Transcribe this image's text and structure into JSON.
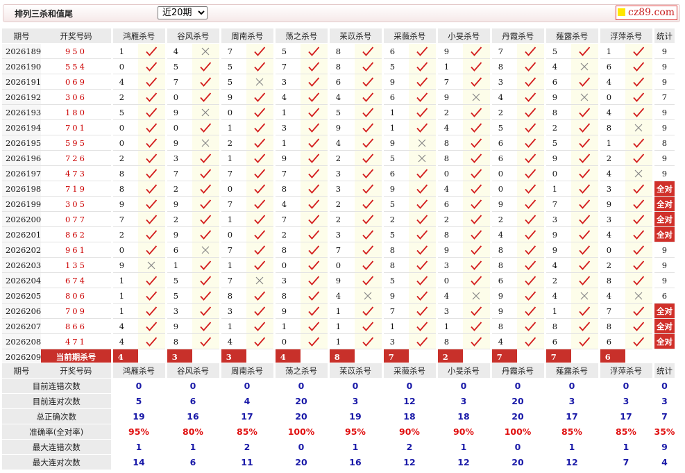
{
  "header": {
    "title": "排列三杀和值尾",
    "period_options": [
      "近20期"
    ],
    "period_selected": "近20期",
    "logo_text": "cz89.com"
  },
  "colors": {
    "red": "#c8302a",
    "blue": "#1a1aa8",
    "right_mark": "#d42020",
    "wrong_mark": "#888888"
  },
  "columns": {
    "issue": "期号",
    "draw": "开奖号码",
    "experts": [
      "鸿雁杀号",
      "谷风杀号",
      "周南杀号",
      "荡之杀号",
      "苿苡杀号",
      "采薇杀号",
      "小旻杀号",
      "丹霞杀号",
      "薤露杀号",
      "浮萍杀号"
    ],
    "total": "统计"
  },
  "rows": [
    {
      "issue": "2026189",
      "draw": "950",
      "picks": [
        [
          1,
          "r"
        ],
        [
          4,
          "w"
        ],
        [
          7,
          "r"
        ],
        [
          5,
          "r"
        ],
        [
          8,
          "r"
        ],
        [
          6,
          "r"
        ],
        [
          9,
          "r"
        ],
        [
          7,
          "r"
        ],
        [
          5,
          "r"
        ],
        [
          1,
          "r"
        ]
      ],
      "total": "9"
    },
    {
      "issue": "2026190",
      "draw": "554",
      "picks": [
        [
          0,
          "r"
        ],
        [
          5,
          "r"
        ],
        [
          5,
          "r"
        ],
        [
          7,
          "r"
        ],
        [
          8,
          "r"
        ],
        [
          5,
          "r"
        ],
        [
          1,
          "r"
        ],
        [
          8,
          "r"
        ],
        [
          4,
          "w"
        ],
        [
          6,
          "r"
        ]
      ],
      "total": "9"
    },
    {
      "issue": "2026191",
      "draw": "069",
      "picks": [
        [
          4,
          "r"
        ],
        [
          7,
          "r"
        ],
        [
          5,
          "w"
        ],
        [
          3,
          "r"
        ],
        [
          6,
          "r"
        ],
        [
          9,
          "r"
        ],
        [
          7,
          "r"
        ],
        [
          3,
          "r"
        ],
        [
          6,
          "r"
        ],
        [
          4,
          "r"
        ]
      ],
      "total": "9"
    },
    {
      "issue": "2026192",
      "draw": "306",
      "picks": [
        [
          2,
          "r"
        ],
        [
          0,
          "r"
        ],
        [
          9,
          "r"
        ],
        [
          4,
          "r"
        ],
        [
          4,
          "r"
        ],
        [
          6,
          "r"
        ],
        [
          9,
          "w"
        ],
        [
          4,
          "r"
        ],
        [
          9,
          "w"
        ],
        [
          0,
          "r"
        ]
      ],
      "total": "7"
    },
    {
      "issue": "2026193",
      "draw": "180",
      "picks": [
        [
          5,
          "r"
        ],
        [
          9,
          "w"
        ],
        [
          0,
          "r"
        ],
        [
          1,
          "r"
        ],
        [
          5,
          "r"
        ],
        [
          1,
          "r"
        ],
        [
          2,
          "r"
        ],
        [
          2,
          "r"
        ],
        [
          8,
          "r"
        ],
        [
          4,
          "r"
        ]
      ],
      "total": "9"
    },
    {
      "issue": "2026194",
      "draw": "701",
      "picks": [
        [
          0,
          "r"
        ],
        [
          0,
          "r"
        ],
        [
          1,
          "r"
        ],
        [
          3,
          "r"
        ],
        [
          9,
          "r"
        ],
        [
          1,
          "r"
        ],
        [
          4,
          "r"
        ],
        [
          5,
          "r"
        ],
        [
          2,
          "r"
        ],
        [
          8,
          "w"
        ]
      ],
      "total": "9"
    },
    {
      "issue": "2026195",
      "draw": "595",
      "picks": [
        [
          0,
          "r"
        ],
        [
          9,
          "w"
        ],
        [
          2,
          "r"
        ],
        [
          1,
          "r"
        ],
        [
          4,
          "r"
        ],
        [
          9,
          "w"
        ],
        [
          8,
          "r"
        ],
        [
          6,
          "r"
        ],
        [
          5,
          "r"
        ],
        [
          1,
          "r"
        ]
      ],
      "total": "8"
    },
    {
      "issue": "2026196",
      "draw": "726",
      "picks": [
        [
          2,
          "r"
        ],
        [
          3,
          "r"
        ],
        [
          1,
          "r"
        ],
        [
          9,
          "r"
        ],
        [
          2,
          "r"
        ],
        [
          5,
          "w"
        ],
        [
          8,
          "r"
        ],
        [
          6,
          "r"
        ],
        [
          9,
          "r"
        ],
        [
          2,
          "r"
        ]
      ],
      "total": "9"
    },
    {
      "issue": "2026197",
      "draw": "473",
      "picks": [
        [
          8,
          "r"
        ],
        [
          7,
          "r"
        ],
        [
          7,
          "r"
        ],
        [
          7,
          "r"
        ],
        [
          3,
          "r"
        ],
        [
          6,
          "r"
        ],
        [
          0,
          "r"
        ],
        [
          0,
          "r"
        ],
        [
          0,
          "r"
        ],
        [
          4,
          "w"
        ]
      ],
      "total": "9"
    },
    {
      "issue": "2026198",
      "draw": "719",
      "picks": [
        [
          8,
          "r"
        ],
        [
          2,
          "r"
        ],
        [
          0,
          "r"
        ],
        [
          8,
          "r"
        ],
        [
          3,
          "r"
        ],
        [
          9,
          "r"
        ],
        [
          4,
          "r"
        ],
        [
          0,
          "r"
        ],
        [
          1,
          "r"
        ],
        [
          3,
          "r"
        ]
      ],
      "total": "全对"
    },
    {
      "issue": "2026199",
      "draw": "305",
      "picks": [
        [
          9,
          "r"
        ],
        [
          9,
          "r"
        ],
        [
          7,
          "r"
        ],
        [
          4,
          "r"
        ],
        [
          2,
          "r"
        ],
        [
          5,
          "r"
        ],
        [
          6,
          "r"
        ],
        [
          9,
          "r"
        ],
        [
          7,
          "r"
        ],
        [
          9,
          "r"
        ]
      ],
      "total": "全对"
    },
    {
      "issue": "2026200",
      "draw": "077",
      "picks": [
        [
          7,
          "r"
        ],
        [
          2,
          "r"
        ],
        [
          1,
          "r"
        ],
        [
          7,
          "r"
        ],
        [
          2,
          "r"
        ],
        [
          2,
          "r"
        ],
        [
          2,
          "r"
        ],
        [
          2,
          "r"
        ],
        [
          3,
          "r"
        ],
        [
          3,
          "r"
        ]
      ],
      "total": "全对"
    },
    {
      "issue": "2026201",
      "draw": "862",
      "picks": [
        [
          2,
          "r"
        ],
        [
          9,
          "r"
        ],
        [
          0,
          "r"
        ],
        [
          2,
          "r"
        ],
        [
          3,
          "r"
        ],
        [
          5,
          "r"
        ],
        [
          8,
          "r"
        ],
        [
          4,
          "r"
        ],
        [
          9,
          "r"
        ],
        [
          4,
          "r"
        ]
      ],
      "total": "全对"
    },
    {
      "issue": "2026202",
      "draw": "961",
      "picks": [
        [
          0,
          "r"
        ],
        [
          6,
          "w"
        ],
        [
          7,
          "r"
        ],
        [
          8,
          "r"
        ],
        [
          7,
          "r"
        ],
        [
          8,
          "r"
        ],
        [
          9,
          "r"
        ],
        [
          8,
          "r"
        ],
        [
          9,
          "r"
        ],
        [
          0,
          "r"
        ]
      ],
      "total": "9"
    },
    {
      "issue": "2026203",
      "draw": "135",
      "picks": [
        [
          9,
          "w"
        ],
        [
          1,
          "r"
        ],
        [
          1,
          "r"
        ],
        [
          0,
          "r"
        ],
        [
          0,
          "r"
        ],
        [
          8,
          "r"
        ],
        [
          3,
          "r"
        ],
        [
          8,
          "r"
        ],
        [
          4,
          "r"
        ],
        [
          2,
          "r"
        ]
      ],
      "total": "9"
    },
    {
      "issue": "2026204",
      "draw": "674",
      "picks": [
        [
          1,
          "r"
        ],
        [
          5,
          "r"
        ],
        [
          7,
          "w"
        ],
        [
          3,
          "r"
        ],
        [
          9,
          "r"
        ],
        [
          5,
          "r"
        ],
        [
          0,
          "r"
        ],
        [
          6,
          "r"
        ],
        [
          2,
          "r"
        ],
        [
          8,
          "r"
        ]
      ],
      "total": "9"
    },
    {
      "issue": "2026205",
      "draw": "806",
      "picks": [
        [
          1,
          "r"
        ],
        [
          5,
          "r"
        ],
        [
          8,
          "r"
        ],
        [
          8,
          "r"
        ],
        [
          4,
          "w"
        ],
        [
          9,
          "r"
        ],
        [
          4,
          "w"
        ],
        [
          9,
          "r"
        ],
        [
          4,
          "w"
        ],
        [
          4,
          "w"
        ]
      ],
      "total": "6"
    },
    {
      "issue": "2026206",
      "draw": "709",
      "picks": [
        [
          1,
          "r"
        ],
        [
          3,
          "r"
        ],
        [
          3,
          "r"
        ],
        [
          9,
          "r"
        ],
        [
          1,
          "r"
        ],
        [
          7,
          "r"
        ],
        [
          3,
          "r"
        ],
        [
          9,
          "r"
        ],
        [
          1,
          "r"
        ],
        [
          7,
          "r"
        ]
      ],
      "total": "全对"
    },
    {
      "issue": "2026207",
      "draw": "866",
      "picks": [
        [
          4,
          "r"
        ],
        [
          9,
          "r"
        ],
        [
          1,
          "r"
        ],
        [
          1,
          "r"
        ],
        [
          1,
          "r"
        ],
        [
          1,
          "r"
        ],
        [
          1,
          "r"
        ],
        [
          8,
          "r"
        ],
        [
          8,
          "r"
        ],
        [
          8,
          "r"
        ]
      ],
      "total": "全对"
    },
    {
      "issue": "2026208",
      "draw": "471",
      "picks": [
        [
          4,
          "r"
        ],
        [
          8,
          "r"
        ],
        [
          4,
          "r"
        ],
        [
          0,
          "r"
        ],
        [
          1,
          "r"
        ],
        [
          3,
          "r"
        ],
        [
          8,
          "r"
        ],
        [
          4,
          "r"
        ],
        [
          6,
          "r"
        ],
        [
          6,
          "r"
        ]
      ],
      "total": "全对"
    }
  ],
  "current": {
    "issue": "2026209",
    "label": "当前期杀号",
    "picks": [
      "4",
      "3",
      "3",
      "4",
      "8",
      "7",
      "2",
      "7",
      "7",
      "6"
    ]
  },
  "stats": {
    "header_issue": "期号",
    "header_draw": "开奖号码",
    "rows": [
      {
        "label": "目前连错次数",
        "values": [
          "0",
          "0",
          "0",
          "0",
          "0",
          "0",
          "0",
          "0",
          "0",
          "0"
        ],
        "total": "0"
      },
      {
        "label": "目前连对次数",
        "values": [
          "5",
          "6",
          "4",
          "20",
          "3",
          "12",
          "3",
          "20",
          "3",
          "3"
        ],
        "total": "3"
      },
      {
        "label": "总正确次数",
        "values": [
          "19",
          "16",
          "17",
          "20",
          "19",
          "18",
          "18",
          "20",
          "17",
          "17"
        ],
        "total": "7"
      },
      {
        "label": "准确率(全对率)",
        "values": [
          "95%",
          "80%",
          "85%",
          "100%",
          "95%",
          "90%",
          "90%",
          "100%",
          "85%",
          "85%"
        ],
        "total": "35%",
        "red": true
      },
      {
        "label": "最大连错次数",
        "values": [
          "1",
          "1",
          "2",
          "0",
          "1",
          "2",
          "1",
          "0",
          "1",
          "1"
        ],
        "total": "9"
      },
      {
        "label": "最大连对次数",
        "values": [
          "14",
          "6",
          "11",
          "20",
          "16",
          "12",
          "12",
          "20",
          "12",
          "7"
        ],
        "total": "4"
      }
    ]
  }
}
